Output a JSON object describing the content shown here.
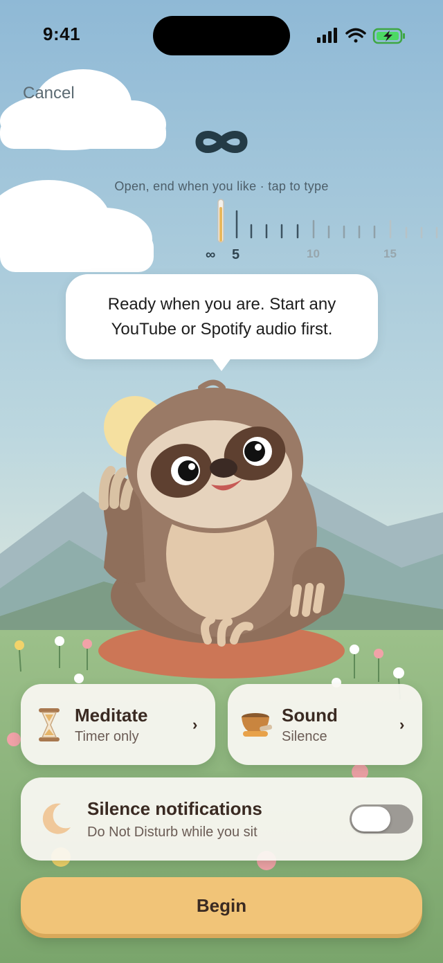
{
  "status_bar": {
    "time": "9:41",
    "signal_icon": "cellular-signal-icon",
    "wifi_icon": "wifi-icon",
    "battery_icon": "battery-charging-icon"
  },
  "header": {
    "cancel_label": "Cancel"
  },
  "duration": {
    "selected_symbol": "∞",
    "caption": "Open, end when you like · tap to type",
    "ruler_labels": [
      "∞",
      "5",
      "10",
      "15"
    ],
    "selected_minutes": "open-ended"
  },
  "bubble": {
    "line1": "Ready when you are. Start any",
    "line2": "YouTube or Spotify audio first."
  },
  "meditate_card": {
    "title": "Meditate",
    "subtitle": "Timer only",
    "icon": "hourglass-icon",
    "chevron": "›"
  },
  "sound_card": {
    "title": "Sound",
    "subtitle": "Silence",
    "icon": "singing-bowl-icon",
    "chevron": "›"
  },
  "notifications_card": {
    "title": "Silence notifications",
    "subtitle": "Do Not Disturb while you sit",
    "icon": "moon-icon",
    "toggle_on": false
  },
  "begin_label": "Begin",
  "colors": {
    "accent": "#f1c478",
    "text": "#3a2a22",
    "sky": "#a9c8d6",
    "grass": "#8fb57f"
  }
}
